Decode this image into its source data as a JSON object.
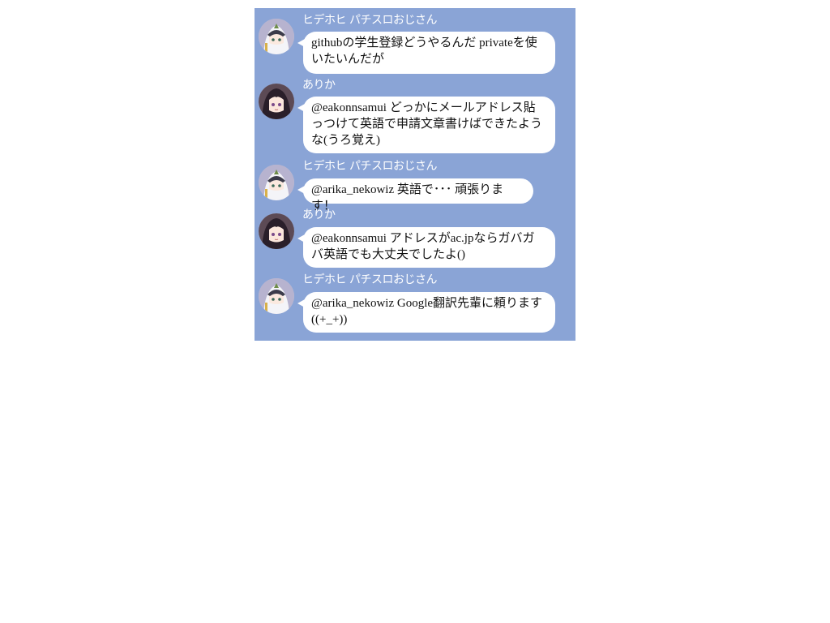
{
  "messages": [
    {
      "sender": "ヒデホヒ パチスロおじさん",
      "avatar": "anime-girl-white-hood-avatar",
      "text": "githubの学生登録どうやるんだ privateを使いたいんだが"
    },
    {
      "sender": "ありか",
      "avatar": "anime-girl-dark-hair-avatar",
      "text": "@eakonnsamui どっかにメールアドレス貼っつけて英語で申請文章書けばできたような(うろ覚え)"
    },
    {
      "sender": "ヒデホヒ パチスロおじさん",
      "avatar": "anime-girl-white-hood-avatar",
      "text": "@arika_nekowiz 英語で･･･ 頑張ります！"
    },
    {
      "sender": "ありか",
      "avatar": "anime-girl-dark-hair-avatar",
      "text": "@eakonnsamui アドレスがac.jpならガバガバ英語でも大丈夫でしたよ()"
    },
    {
      "sender": "ヒデホヒ パチスロおじさん",
      "avatar": "anime-girl-white-hood-avatar",
      "text": "@arika_nekowiz Google翻訳先輩に頼ります((+_+))"
    }
  ],
  "colors": {
    "panel_background": "#8aa4d6",
    "bubble_background": "#ffffff",
    "sender_text": "#ffffff"
  }
}
